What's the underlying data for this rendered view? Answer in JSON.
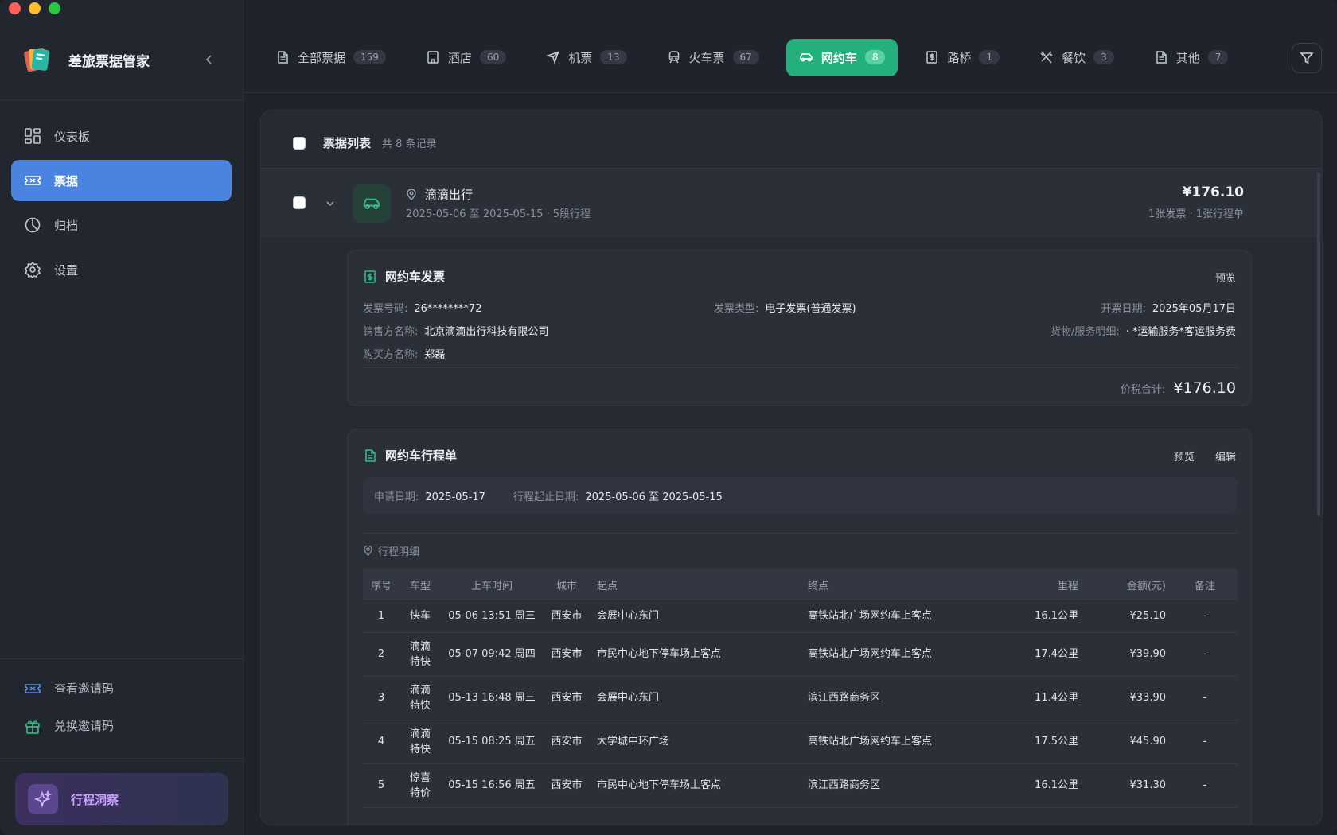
{
  "app": {
    "title": "差旅票据管家"
  },
  "sidebar": {
    "items": [
      {
        "label": "仪表板",
        "icon": "dashboard-icon",
        "active": false
      },
      {
        "label": "票据",
        "icon": "ticket-icon",
        "active": true
      },
      {
        "label": "归档",
        "icon": "archive-icon",
        "active": false
      },
      {
        "label": "设置",
        "icon": "gear-icon",
        "active": false
      }
    ],
    "bottom": [
      {
        "label": "查看邀请码",
        "icon": "ticket-icon"
      },
      {
        "label": "兑换邀请码",
        "icon": "gift-icon"
      }
    ],
    "insight_label": "行程洞察"
  },
  "tabs": [
    {
      "label": "全部票据",
      "count": "159",
      "icon": "document-icon"
    },
    {
      "label": "酒店",
      "count": "60",
      "icon": "hotel-icon"
    },
    {
      "label": "机票",
      "count": "13",
      "icon": "plane-icon"
    },
    {
      "label": "火车票",
      "count": "67",
      "icon": "train-icon"
    },
    {
      "label": "网约车",
      "count": "8",
      "icon": "car-icon",
      "active": true
    },
    {
      "label": "路桥",
      "count": "1",
      "icon": "toll-icon"
    },
    {
      "label": "餐饮",
      "count": "3",
      "icon": "utensils-icon"
    },
    {
      "label": "其他",
      "count": "7",
      "icon": "document-icon"
    }
  ],
  "list": {
    "title": "票据列表",
    "count_text": "共 8 条记录"
  },
  "record": {
    "vendor": "滴滴出行",
    "subtitle": "2025-05-06 至 2025-05-15 · 5段行程",
    "amount": "¥176.10",
    "meta": "1张发票 · 1张行程单"
  },
  "invoice": {
    "title": "网约车发票",
    "preview": "预览",
    "number_label": "发票号码:",
    "number": "26********72",
    "type_label": "发票类型:",
    "type": "电子发票(普通发票)",
    "date_label": "开票日期:",
    "date": "2025年05月17日",
    "seller_label": "销售方名称:",
    "seller": "北京滴滴出行科技有限公司",
    "goods_label": "货物/服务明细:",
    "goods": "· *运输服务*客运服务费",
    "buyer_label": "购买方名称:",
    "buyer": "郑磊",
    "total_label": "价税合计:",
    "total": "¥176.10"
  },
  "itinerary": {
    "title": "网约车行程单",
    "preview": "预览",
    "edit": "编辑",
    "apply_label": "申请日期:",
    "apply_date": "2025-05-17",
    "range_label": "行程起止日期:",
    "range": "2025-05-06 至 2025-05-15",
    "detail_label": "行程明细",
    "columns": [
      "序号",
      "车型",
      "上车时间",
      "城市",
      "起点",
      "终点",
      "里程",
      "金额(元)",
      "备注"
    ],
    "rows": [
      [
        "1",
        "快车",
        "05-06 13:51 周三",
        "西安市",
        "会展中心东门",
        "高铁站北广场网约车上客点",
        "16.1公里",
        "¥25.10",
        "-"
      ],
      [
        "2",
        "滴滴特快",
        "05-07 09:42 周四",
        "西安市",
        "市民中心地下停车场上客点",
        "高铁站北广场网约车上客点",
        "17.4公里",
        "¥39.90",
        "-"
      ],
      [
        "3",
        "滴滴特快",
        "05-13 16:48 周三",
        "西安市",
        "会展中心东门",
        "滨江西路商务区",
        "11.4公里",
        "¥33.90",
        "-"
      ],
      [
        "4",
        "滴滴特快",
        "05-15 08:25 周五",
        "西安市",
        "大学城中环广场",
        "高铁站北广场网约车上客点",
        "17.5公里",
        "¥45.90",
        "-"
      ],
      [
        "5",
        "惊喜特价",
        "05-15 16:56 周五",
        "西安市",
        "市民中心地下停车场上客点",
        "滨江西路商务区",
        "16.1公里",
        "¥31.30",
        "-"
      ]
    ]
  },
  "colors": {
    "accent_green": "#23b07c",
    "accent_blue": "#4a84e0",
    "insight_purple": "#c9a5ff"
  }
}
